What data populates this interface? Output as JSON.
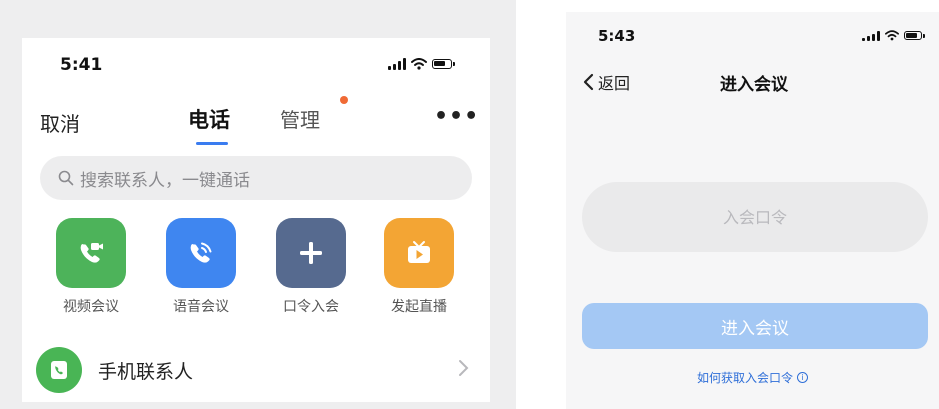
{
  "left_screen": {
    "status_time": "5:41",
    "nav": {
      "cancel_label": "取消",
      "tab_phone_label": "电话",
      "tab_manage_label": "管理",
      "more_label": "•••"
    },
    "search": {
      "placeholder": "搜索联系人，一键通话"
    },
    "actions": [
      {
        "label": "视频会议",
        "icon": "video-call-icon",
        "color": "#4db35a"
      },
      {
        "label": "语音会议",
        "icon": "voice-call-icon",
        "color": "#3f86f0"
      },
      {
        "label": "口令入会",
        "icon": "plus-icon",
        "color": "#566a8f"
      },
      {
        "label": "发起直播",
        "icon": "tv-live-icon",
        "color": "#f3a534"
      }
    ],
    "contact_row": {
      "label": "手机联系人",
      "icon": "phone-book-icon",
      "color": "#49b555"
    }
  },
  "right_screen": {
    "status_time": "5:43",
    "back_label": "返回",
    "title": "进入会议",
    "passcode_placeholder": "入会口令",
    "join_button_label": "进入会议",
    "help_link_label": "如何获取入会口令"
  },
  "colors": {
    "accent_blue": "#3a7cf0",
    "notification_dot": "#f06a35",
    "disabled_button": "#a4c8f4",
    "link_blue": "#2f6fd8"
  }
}
